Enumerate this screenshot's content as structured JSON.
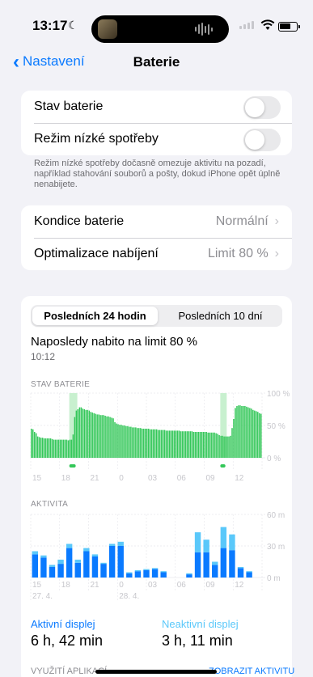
{
  "status": {
    "time": "13:17"
  },
  "nav": {
    "back_label": "Nastavení",
    "title": "Baterie"
  },
  "group1": {
    "rows": [
      {
        "label": "Stav baterie",
        "toggle_on": false
      },
      {
        "label": "Režim nízké spotřeby",
        "toggle_on": false
      }
    ],
    "footnote": "Režim nízké spotřeby dočasně omezuje aktivitu na pozadí, například stahování souborů a pošty, dokud iPhone opět úplně nenabijete."
  },
  "group2": {
    "rows": [
      {
        "label": "Kondice baterie",
        "value": "Normální"
      },
      {
        "label": "Optimalizace nabíjení",
        "value": "Limit 80 %"
      }
    ]
  },
  "usage": {
    "segments": [
      "Posledních 24 hodin",
      "Posledních 10 dní"
    ],
    "selected_segment": 0,
    "last_charged": "Naposledy nabito na limit 80 %",
    "last_charged_time": "10:12",
    "battery_section_label": "STAV BATERIE",
    "activity_section_label": "AKTIVITA",
    "colors": {
      "battery": "#34c759",
      "charging_bg": "#c8f0cf",
      "active": "#0a7aff",
      "inactive": "#5ac8fa"
    }
  },
  "chart_data": [
    {
      "type": "bar",
      "title": "STAV BATERIE",
      "y_ticks": [
        "100 %",
        "50 %",
        "0 %"
      ],
      "ylim": [
        0,
        100
      ],
      "x_ticks": [
        "15",
        "18",
        "21",
        "0",
        "03",
        "06",
        "09",
        "12"
      ],
      "values": [
        45,
        44,
        40,
        38,
        33,
        32,
        31,
        31,
        30,
        30,
        30,
        30,
        30,
        29,
        28,
        28,
        28,
        28,
        28,
        28,
        28,
        28,
        28,
        27,
        28,
        28,
        36,
        63,
        73,
        75,
        78,
        78,
        76,
        75,
        74,
        74,
        73,
        71,
        70,
        69,
        68,
        67,
        67,
        66,
        66,
        66,
        65,
        64,
        64,
        63,
        62,
        61,
        55,
        53,
        52,
        51,
        51,
        50,
        50,
        49,
        49,
        48,
        48,
        47,
        47,
        47,
        46,
        46,
        46,
        45,
        45,
        45,
        45,
        45,
        44,
        44,
        44,
        44,
        44,
        43,
        43,
        43,
        43,
        43,
        42,
        42,
        42,
        42,
        42,
        42,
        42,
        42,
        42,
        41,
        41,
        41,
        41,
        41,
        41,
        41,
        41,
        40,
        40,
        40,
        40,
        40,
        40,
        40,
        40,
        40,
        39,
        39,
        39,
        39,
        39,
        38,
        37,
        35,
        34,
        34,
        33,
        33,
        33,
        33,
        34,
        46,
        60,
        77,
        80,
        81,
        81,
        80,
        80,
        80,
        79,
        78,
        77,
        76,
        74,
        73,
        72,
        71,
        69,
        68
      ],
      "charging_ranges": [
        [
          24,
          29
        ],
        [
          118,
          122
        ]
      ]
    },
    {
      "type": "bar",
      "title": "AKTIVITA",
      "y_ticks": [
        "60 m",
        "30 m",
        "0 m"
      ],
      "ylim": [
        0,
        60
      ],
      "x_ticks": [
        "15",
        "18",
        "21",
        "0",
        "03",
        "06",
        "09",
        "12"
      ],
      "date_labels": [
        "27. 4.",
        "28. 4."
      ],
      "series": [
        {
          "name": "Aktivní displej",
          "values": [
            22,
            19,
            10,
            13,
            28,
            14,
            25,
            20,
            13,
            30,
            30,
            4,
            6,
            7,
            8,
            5,
            0,
            0,
            3,
            24,
            24,
            12,
            28,
            26,
            9,
            5,
            0
          ]
        },
        {
          "name": "Neaktivní displej",
          "values": [
            3,
            2,
            2,
            4,
            4,
            3,
            3,
            2,
            1,
            2,
            4,
            1,
            1,
            1,
            1,
            1,
            0,
            0,
            1,
            19,
            12,
            3,
            20,
            15,
            1,
            1,
            0
          ]
        }
      ]
    }
  ],
  "legend": {
    "active": {
      "label": "Aktivní displej",
      "value": "6 h, 42 min"
    },
    "inactive": {
      "label": "Neaktivní displej",
      "value": "3 h, 11 min"
    }
  },
  "bottom": {
    "label": "VYUŽITÍ APLIKACÍ",
    "link": "ZOBRAZIT AKTIVITU"
  }
}
